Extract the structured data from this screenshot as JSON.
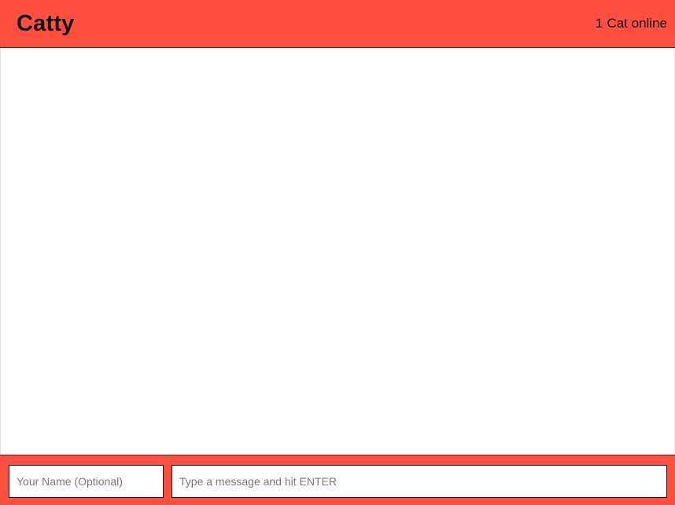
{
  "header": {
    "title": "Catty",
    "online_count": "1",
    "online_label": "Cat online"
  },
  "messages": [],
  "footer": {
    "name_input": {
      "value": "",
      "placeholder": "Your Name (Optional)"
    },
    "message_input": {
      "value": "",
      "placeholder": "Type a message and hit ENTER"
    }
  },
  "colors": {
    "accent": "#ff4f3f",
    "text": "#111111",
    "background": "#ffffff"
  }
}
